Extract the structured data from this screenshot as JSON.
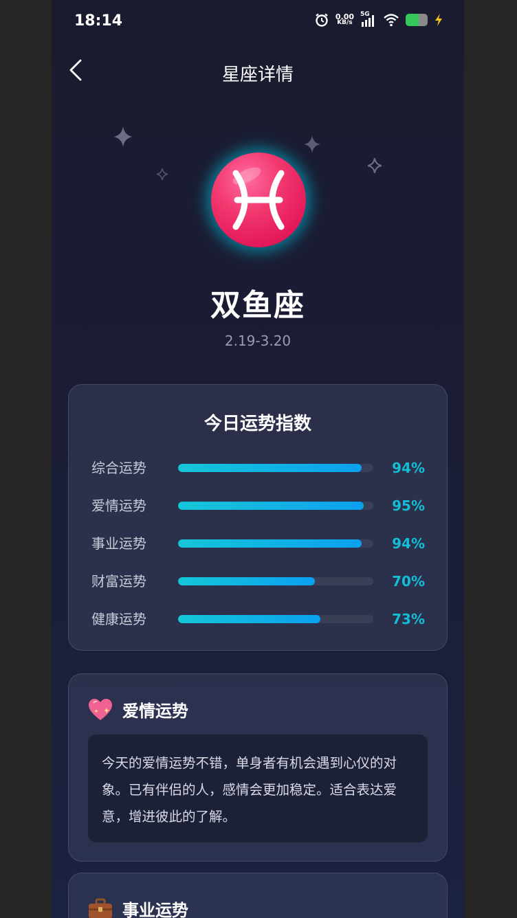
{
  "status_bar": {
    "time": "18:14",
    "net_speed_value": "0.00",
    "net_speed_unit": "KB/s",
    "network": "5G",
    "battery_level": 0.6
  },
  "nav": {
    "title": "星座详情"
  },
  "hero": {
    "sign_name": "双鱼座",
    "dates": "2.19-3.20",
    "sign_symbol": "pisces-symbol-icon",
    "accent_color": "#e91e63"
  },
  "fortune_index": {
    "title": "今日运势指数",
    "metrics": [
      {
        "label": "综合运势",
        "value": 94,
        "display": "94%"
      },
      {
        "label": "爱情运势",
        "value": 95,
        "display": "95%"
      },
      {
        "label": "事业运势",
        "value": 94,
        "display": "94%"
      },
      {
        "label": "财富运势",
        "value": 70,
        "display": "70%"
      },
      {
        "label": "健康运势",
        "value": 73,
        "display": "73%"
      }
    ],
    "bar_color": "#12bfd6"
  },
  "love": {
    "emoji": "💖",
    "title": "爱情运势",
    "body": "今天的爱情运势不错，单身者有机会遇到心仪的对象。已有伴侣的人，感情会更加稳定。适合表达爱意，增进彼此的了解。"
  },
  "career": {
    "emoji": "💼",
    "title": "事业运势"
  }
}
